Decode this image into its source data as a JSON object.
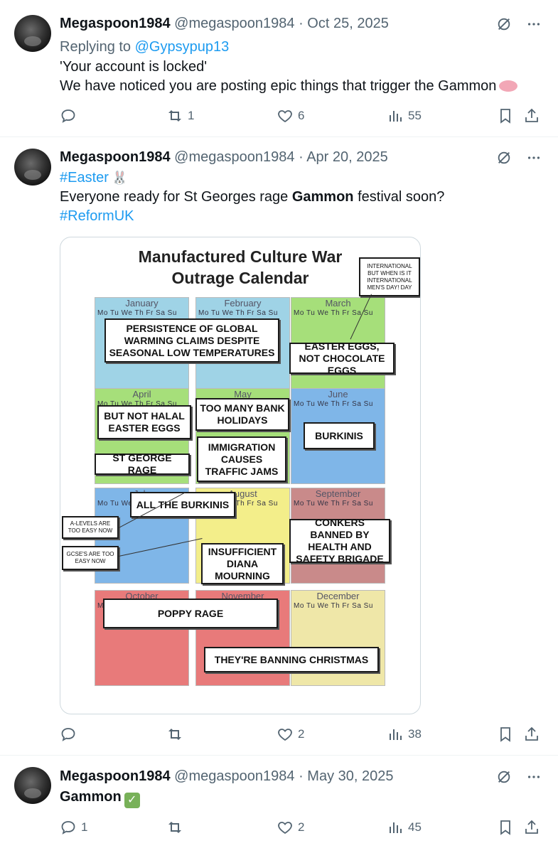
{
  "tweets": [
    {
      "name": "Megaspoon1984",
      "handle": "@megaspoon1984",
      "dot": "·",
      "date": "Oct 25, 2025",
      "reply_prefix": "Replying to",
      "reply_to": "@Gypsypup13",
      "line1": "'Your account is locked'",
      "line2": "We have noticed you are posting epic things that trigger the Gammon",
      "counts": {
        "reply": "",
        "retweet": "1",
        "like": "6",
        "views": "55"
      }
    },
    {
      "name": "Megaspoon1984",
      "handle": "@megaspoon1984",
      "dot": "·",
      "date": "Apr 20, 2025",
      "hashtag1": "#Easter",
      "line_pre": "Everyone ready for St Georges rage",
      "line_bold": "Gammon",
      "line_post": "festival soon?",
      "hashtag2": "#ReformUK",
      "counts": {
        "reply": "",
        "retweet": "",
        "like": "2",
        "views": "38"
      }
    },
    {
      "name": "Megaspoon1984",
      "handle": "@megaspoon1984",
      "dot": "·",
      "date": "May 30, 2025",
      "text": "Gammon",
      "counts": {
        "reply": "1",
        "retweet": "",
        "like": "2",
        "views": "45"
      }
    }
  ],
  "calendar": {
    "title_line1": "Manufactured Culture War",
    "title_line2": "Outrage Calendar",
    "dow": "Mo Tu We Th Fr Sa Su",
    "months": [
      {
        "name": "January",
        "color": "#9fd3e6"
      },
      {
        "name": "February",
        "color": "#9fd3e6"
      },
      {
        "name": "March",
        "color": "#a6df7a"
      },
      {
        "name": "April",
        "color": "#a6df7a"
      },
      {
        "name": "May",
        "color": "#a6df7a"
      },
      {
        "name": "June",
        "color": "#7fb6e8"
      },
      {
        "name": "July",
        "color": "#7fb6e8"
      },
      {
        "name": "August",
        "color": "#f3ee8a"
      },
      {
        "name": "September",
        "color": "#c98a8a"
      },
      {
        "name": "October",
        "color": "#e87a7a"
      },
      {
        "name": "November",
        "color": "#e87a7a"
      },
      {
        "name": "December",
        "color": "#efe7a8"
      }
    ],
    "labels": {
      "international": "INTERNATIONAL BUT WHEN IS IT INTERNATIONAL MEN'S DAY! DAY",
      "global_warming": "PERSISTENCE OF GLOBAL WARMING CLAIMS DESPITE SEASONAL LOW TEMPERATURES",
      "easter_eggs": "EASTER EGGS, NOT CHOCOLATE EGGS",
      "halal": "BUT NOT HALAL EASTER EGGS",
      "bank_holidays": "TOO MANY BANK HOLIDAYS",
      "burkinis": "BURKINIS",
      "immigration": "IMMIGRATION CAUSES TRAFFIC JAMS",
      "st_george": "ST GEORGE RAGE",
      "all_burkinis": "ALL THE BURKINIS",
      "a_levels": "A-LEVELS ARE TOO EASY NOW",
      "gcses": "GCSE'S ARE TOO EASY NOW",
      "conkers": "CONKERS BANNED BY HEALTH AND SAFETY BRIGADE",
      "diana": "INSUFFICIENT DIANA MOURNING",
      "poppy": "POPPY RAGE",
      "christmas": "THEY'RE BANNING CHRISTMAS"
    }
  },
  "colors": {
    "accent": "#1d9bf0",
    "muted": "#536471",
    "border": "#cfd9de"
  },
  "icons": {
    "reply": "reply-icon",
    "retweet": "retweet-icon",
    "like": "heart-icon",
    "views": "views-icon",
    "bookmark": "bookmark-icon",
    "share": "share-icon",
    "grok": "grok-icon",
    "more": "more-icon"
  }
}
